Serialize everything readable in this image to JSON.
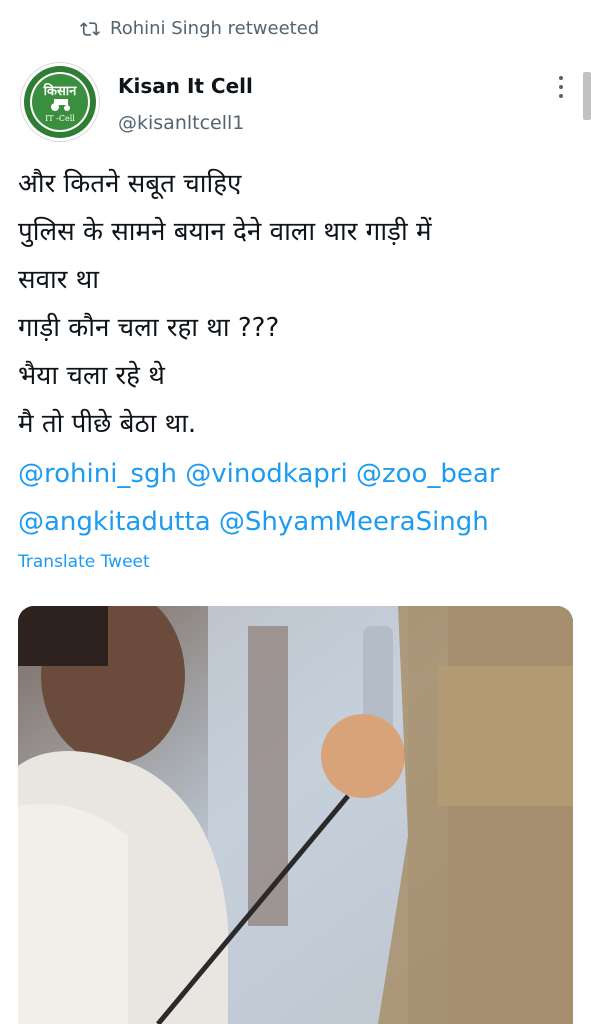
{
  "retweet": {
    "label": "Rohini Singh retweeted",
    "icon": "retweet-icon"
  },
  "author": {
    "name": "Kisan It Cell",
    "handle": "@kisanltcell1",
    "avatar_text_top": "किसान",
    "avatar_text_bottom": "IT -Cell"
  },
  "tweet": {
    "lines": [
      "और कितने सबूत चाहिए",
      "पुलिस के सामने बयान देने वाला थार गाड़ी में",
      "सवार था",
      "गाड़ी कौन चला रहा था ???",
      "भैया चला रहे थे",
      "मै तो पीछे बेठा था."
    ],
    "mentions": [
      "@rohini_sgh",
      "@vinodkapri",
      "@zoo_bear",
      "@angkitadutta",
      "@ShyamMeeraSingh"
    ],
    "translate_label": "Translate Tweet"
  },
  "colors": {
    "link": "#1d9bf0",
    "secondary_text": "#536471",
    "avatar_green": "#2e7d32"
  }
}
